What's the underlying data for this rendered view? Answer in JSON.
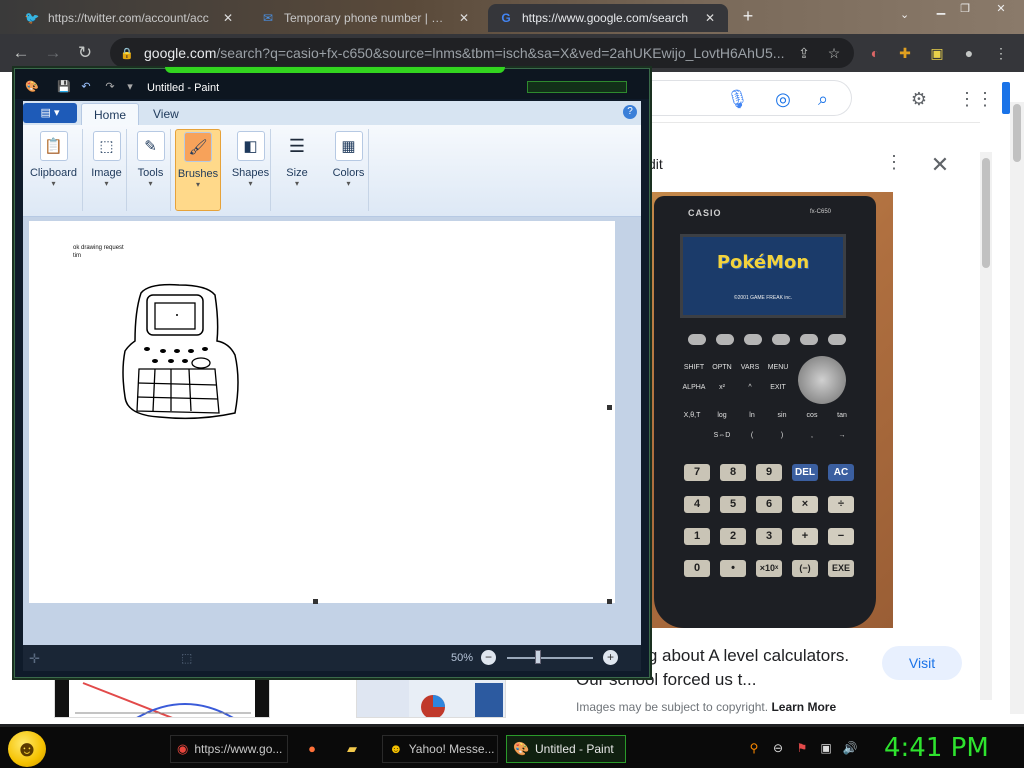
{
  "browser": {
    "tabs": [
      {
        "label": "https://twitter.com/account/acc",
        "icon": "twitter-icon"
      },
      {
        "label": "Temporary phone number | Rec",
        "icon": "mail-icon"
      },
      {
        "label": "https://www.google.com/search",
        "icon": "google-icon"
      }
    ],
    "new_tab": "+",
    "url_domain": "google.com",
    "url_rest": "/search?q=casio+fx-c650&source=lnms&tbm=isch&sa=X&ved=2ahUKEwijo_LovtH6AhU5..."
  },
  "google": {
    "panel_title": "dit",
    "caption": "ose asking about A level calculators. Our school forced us t...",
    "visit_label": "Visit",
    "copyright_text": "Images may be subject to copyright.",
    "learn_more": "Learn More",
    "calculator": {
      "brand": "CASIO",
      "model": "fx-C650",
      "screen_title": "PokéMon",
      "screen_sub": "©2001 GAME FREAK inc.",
      "keys_row1": [
        "7",
        "8",
        "9",
        "DEL",
        "AC"
      ],
      "keys_row2": [
        "4",
        "5",
        "6",
        "×",
        "÷"
      ],
      "keys_row3": [
        "1",
        "2",
        "3",
        "+",
        "−"
      ],
      "keys_row4": [
        "0",
        "•",
        "×10ˣ",
        "(−)",
        "EXE"
      ],
      "small_row1": [
        "SHIFT",
        "OPTN",
        "VARS",
        "MENU"
      ],
      "small_row2": [
        "ALPHA",
        "x²",
        "^",
        "EXIT"
      ],
      "small_row3": [
        "X,θ,T",
        "log",
        "ln",
        "sin",
        "cos",
        "tan"
      ],
      "small_row4": [
        "",
        "S⇔D",
        "(",
        ")",
        ",",
        "→"
      ]
    }
  },
  "paint": {
    "title": "Untitled - Paint",
    "menu_label": "▤ ▾",
    "tabs": [
      "Home",
      "View"
    ],
    "groups": [
      {
        "label": "Clipboard",
        "icon": "clipboard-icon"
      },
      {
        "label": "Image",
        "icon": "select-icon"
      },
      {
        "label": "Tools",
        "icon": "tools-icon"
      },
      {
        "label": "Brushes",
        "icon": "brush-icon"
      },
      {
        "label": "Shapes",
        "icon": "shapes-icon"
      },
      {
        "label": "Size",
        "icon": "size-icon"
      },
      {
        "label": "Colors",
        "icon": "colors-icon"
      }
    ],
    "canvas_text_line1": "ok drawing request",
    "canvas_text_line2": "tim",
    "zoom": "50%",
    "help": "?"
  },
  "taskbar": {
    "items": [
      {
        "label": "https://www.go...",
        "icon": "chrome-icon"
      },
      {
        "label": "",
        "icon": "firefox-icon"
      },
      {
        "label": "",
        "icon": "folder-icon"
      },
      {
        "label": "Yahoo! Messe...",
        "icon": "yahoo-icon"
      },
      {
        "label": "Untitled - Paint",
        "icon": "paint-icon"
      }
    ],
    "clock": "4:41 PM"
  },
  "colors": {
    "accent_green": "#2ee32e",
    "google_blue": "#1a73e8",
    "paint_selected": "#ffd98a"
  }
}
